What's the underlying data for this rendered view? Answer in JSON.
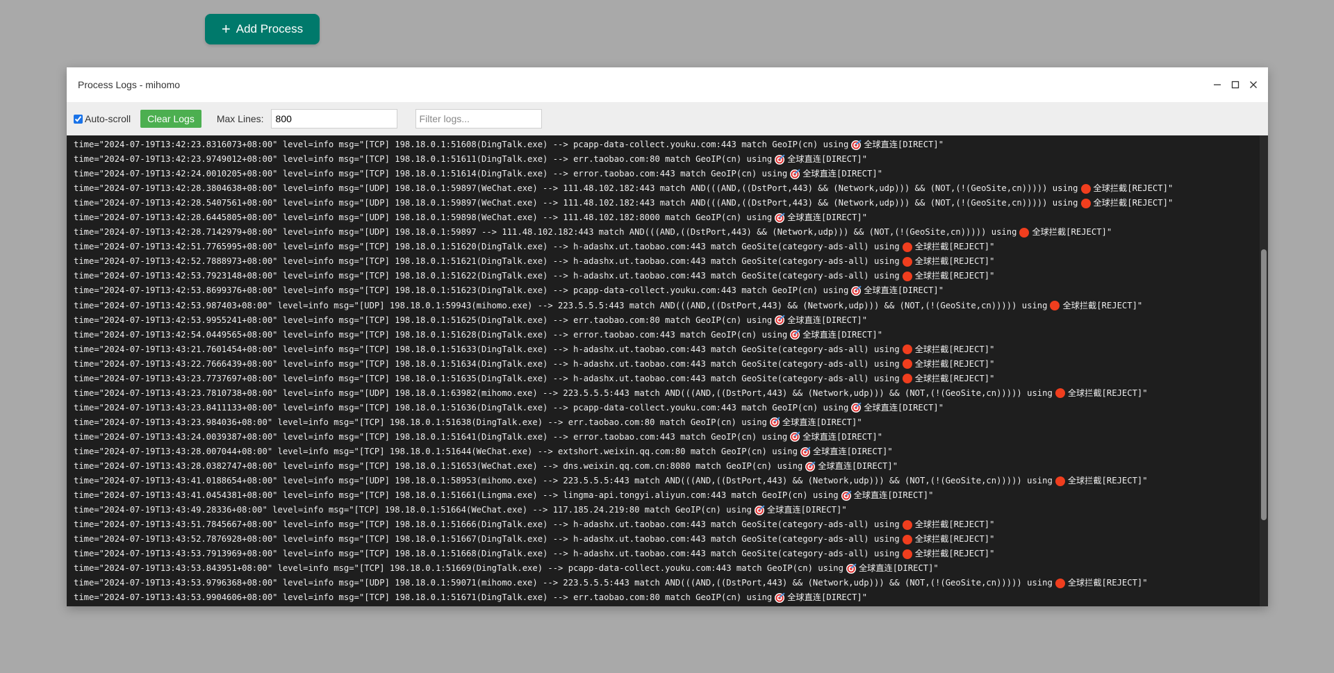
{
  "add_process": {
    "label": "Add Process",
    "icon": "plus-icon"
  },
  "modal": {
    "title": "Process Logs - mihomo",
    "controls": [
      "minimize-icon",
      "maximize-icon",
      "close-icon"
    ]
  },
  "toolbar": {
    "autoscroll_label": "Auto-scroll",
    "autoscroll_checked": true,
    "clear_label": "Clear Logs",
    "maxlines_label": "Max Lines:",
    "maxlines_value": "800",
    "filter_placeholder": "Filter logs..."
  },
  "colors": {
    "add_button": "#00796b",
    "clear_button": "#4caf50",
    "log_background": "#1e1e1e",
    "overlay": "#a9a9a9"
  },
  "logs": [
    {
      "pre": "time=\"2024-07-19T13:42:23.8316073+08:00\" level=info msg=\"[TCP] 198.18.0.1:51608(DingTalk.exe) --> pcapp-data-collect.youku.com:443 match GeoIP(cn) using",
      "emoji": "target",
      "post": "全球直连[DIRECT]\""
    },
    {
      "pre": "time=\"2024-07-19T13:42:23.9749012+08:00\" level=info msg=\"[TCP] 198.18.0.1:51611(DingTalk.exe) --> err.taobao.com:80 match GeoIP(cn) using",
      "emoji": "target",
      "post": "全球直连[DIRECT]\""
    },
    {
      "pre": "time=\"2024-07-19T13:42:24.0010205+08:00\" level=info msg=\"[TCP] 198.18.0.1:51614(DingTalk.exe) --> error.taobao.com:443 match GeoIP(cn) using",
      "emoji": "target",
      "post": "全球直连[DIRECT]\""
    },
    {
      "pre": "time=\"2024-07-19T13:42:28.3804638+08:00\" level=info msg=\"[UDP] 198.18.0.1:59897(WeChat.exe) --> 111.48.102.182:443 match AND(((AND,((DstPort,443) && (Network,udp))) && (NOT,(!(GeoSite,cn))))) using",
      "emoji": "circle",
      "post": "全球拦截[REJECT]\""
    },
    {
      "pre": "time=\"2024-07-19T13:42:28.5407561+08:00\" level=info msg=\"[UDP] 198.18.0.1:59897(WeChat.exe) --> 111.48.102.182:443 match AND(((AND,((DstPort,443) && (Network,udp))) && (NOT,(!(GeoSite,cn))))) using",
      "emoji": "circle",
      "post": "全球拦截[REJECT]\""
    },
    {
      "pre": "time=\"2024-07-19T13:42:28.6445805+08:00\" level=info msg=\"[UDP] 198.18.0.1:59898(WeChat.exe) --> 111.48.102.182:8000 match GeoIP(cn) using",
      "emoji": "target",
      "post": "全球直连[DIRECT]\""
    },
    {
      "pre": "time=\"2024-07-19T13:42:28.7142979+08:00\" level=info msg=\"[UDP] 198.18.0.1:59897 --> 111.48.102.182:443 match AND(((AND,((DstPort,443) && (Network,udp))) && (NOT,(!(GeoSite,cn))))) using",
      "emoji": "circle",
      "post": "全球拦截[REJECT]\""
    },
    {
      "pre": "time=\"2024-07-19T13:42:51.7765995+08:00\" level=info msg=\"[TCP] 198.18.0.1:51620(DingTalk.exe) --> h-adashx.ut.taobao.com:443 match GeoSite(category-ads-all) using",
      "emoji": "circle",
      "post": "全球拦截[REJECT]\""
    },
    {
      "pre": "time=\"2024-07-19T13:42:52.7888973+08:00\" level=info msg=\"[TCP] 198.18.0.1:51621(DingTalk.exe) --> h-adashx.ut.taobao.com:443 match GeoSite(category-ads-all) using",
      "emoji": "circle",
      "post": "全球拦截[REJECT]\""
    },
    {
      "pre": "time=\"2024-07-19T13:42:53.7923148+08:00\" level=info msg=\"[TCP] 198.18.0.1:51622(DingTalk.exe) --> h-adashx.ut.taobao.com:443 match GeoSite(category-ads-all) using",
      "emoji": "circle",
      "post": "全球拦截[REJECT]\""
    },
    {
      "pre": "time=\"2024-07-19T13:42:53.8699376+08:00\" level=info msg=\"[TCP] 198.18.0.1:51623(DingTalk.exe) --> pcapp-data-collect.youku.com:443 match GeoIP(cn) using",
      "emoji": "target",
      "post": "全球直连[DIRECT]\""
    },
    {
      "pre": "time=\"2024-07-19T13:42:53.987403+08:00\" level=info msg=\"[UDP] 198.18.0.1:59943(mihomo.exe) --> 223.5.5.5:443 match AND(((AND,((DstPort,443) && (Network,udp))) && (NOT,(!(GeoSite,cn))))) using",
      "emoji": "circle",
      "post": "全球拦截[REJECT]\""
    },
    {
      "pre": "time=\"2024-07-19T13:42:53.9955241+08:00\" level=info msg=\"[TCP] 198.18.0.1:51625(DingTalk.exe) --> err.taobao.com:80 match GeoIP(cn) using",
      "emoji": "target",
      "post": "全球直连[DIRECT]\""
    },
    {
      "pre": "time=\"2024-07-19T13:42:54.0449565+08:00\" level=info msg=\"[TCP] 198.18.0.1:51628(DingTalk.exe) --> error.taobao.com:443 match GeoIP(cn) using",
      "emoji": "target",
      "post": "全球直连[DIRECT]\""
    },
    {
      "pre": "time=\"2024-07-19T13:43:21.7601454+08:00\" level=info msg=\"[TCP] 198.18.0.1:51633(DingTalk.exe) --> h-adashx.ut.taobao.com:443 match GeoSite(category-ads-all) using",
      "emoji": "circle",
      "post": "全球拦截[REJECT]\""
    },
    {
      "pre": "time=\"2024-07-19T13:43:22.7666439+08:00\" level=info msg=\"[TCP] 198.18.0.1:51634(DingTalk.exe) --> h-adashx.ut.taobao.com:443 match GeoSite(category-ads-all) using",
      "emoji": "circle",
      "post": "全球拦截[REJECT]\""
    },
    {
      "pre": "time=\"2024-07-19T13:43:23.7737697+08:00\" level=info msg=\"[TCP] 198.18.0.1:51635(DingTalk.exe) --> h-adashx.ut.taobao.com:443 match GeoSite(category-ads-all) using",
      "emoji": "circle",
      "post": "全球拦截[REJECT]\""
    },
    {
      "pre": "time=\"2024-07-19T13:43:23.7810738+08:00\" level=info msg=\"[UDP] 198.18.0.1:63982(mihomo.exe) --> 223.5.5.5:443 match AND(((AND,((DstPort,443) && (Network,udp))) && (NOT,(!(GeoSite,cn))))) using",
      "emoji": "circle",
      "post": "全球拦截[REJECT]\""
    },
    {
      "pre": "time=\"2024-07-19T13:43:23.8411133+08:00\" level=info msg=\"[TCP] 198.18.0.1:51636(DingTalk.exe) --> pcapp-data-collect.youku.com:443 match GeoIP(cn) using",
      "emoji": "target",
      "post": "全球直连[DIRECT]\""
    },
    {
      "pre": "time=\"2024-07-19T13:43:23.984036+08:00\" level=info msg=\"[TCP] 198.18.0.1:51638(DingTalk.exe) --> err.taobao.com:80 match GeoIP(cn) using",
      "emoji": "target",
      "post": "全球直连[DIRECT]\""
    },
    {
      "pre": "time=\"2024-07-19T13:43:24.0039387+08:00\" level=info msg=\"[TCP] 198.18.0.1:51641(DingTalk.exe) --> error.taobao.com:443 match GeoIP(cn) using",
      "emoji": "target",
      "post": "全球直连[DIRECT]\""
    },
    {
      "pre": "time=\"2024-07-19T13:43:28.007044+08:00\" level=info msg=\"[TCP] 198.18.0.1:51644(WeChat.exe) --> extshort.weixin.qq.com:80 match GeoIP(cn) using",
      "emoji": "target",
      "post": "全球直连[DIRECT]\""
    },
    {
      "pre": "time=\"2024-07-19T13:43:28.0382747+08:00\" level=info msg=\"[TCP] 198.18.0.1:51653(WeChat.exe) --> dns.weixin.qq.com.cn:8080 match GeoIP(cn) using",
      "emoji": "target",
      "post": "全球直连[DIRECT]\""
    },
    {
      "pre": "time=\"2024-07-19T13:43:41.0188654+08:00\" level=info msg=\"[UDP] 198.18.0.1:58953(mihomo.exe) --> 223.5.5.5:443 match AND(((AND,((DstPort,443) && (Network,udp))) && (NOT,(!(GeoSite,cn))))) using",
      "emoji": "circle",
      "post": "全球拦截[REJECT]\""
    },
    {
      "pre": "time=\"2024-07-19T13:43:41.0454381+08:00\" level=info msg=\"[TCP] 198.18.0.1:51661(Lingma.exe) --> lingma-api.tongyi.aliyun.com:443 match GeoIP(cn) using",
      "emoji": "target",
      "post": "全球直连[DIRECT]\""
    },
    {
      "pre": "time=\"2024-07-19T13:43:49.28336+08:00\" level=info msg=\"[TCP] 198.18.0.1:51664(WeChat.exe) --> 117.185.24.219:80 match GeoIP(cn) using",
      "emoji": "target",
      "post": "全球直连[DIRECT]\""
    },
    {
      "pre": "time=\"2024-07-19T13:43:51.7845667+08:00\" level=info msg=\"[TCP] 198.18.0.1:51666(DingTalk.exe) --> h-adashx.ut.taobao.com:443 match GeoSite(category-ads-all) using",
      "emoji": "circle",
      "post": "全球拦截[REJECT]\""
    },
    {
      "pre": "time=\"2024-07-19T13:43:52.7876928+08:00\" level=info msg=\"[TCP] 198.18.0.1:51667(DingTalk.exe) --> h-adashx.ut.taobao.com:443 match GeoSite(category-ads-all) using",
      "emoji": "circle",
      "post": "全球拦截[REJECT]\""
    },
    {
      "pre": "time=\"2024-07-19T13:43:53.7913969+08:00\" level=info msg=\"[TCP] 198.18.0.1:51668(DingTalk.exe) --> h-adashx.ut.taobao.com:443 match GeoSite(category-ads-all) using",
      "emoji": "circle",
      "post": "全球拦截[REJECT]\""
    },
    {
      "pre": "time=\"2024-07-19T13:43:53.843951+08:00\" level=info msg=\"[TCP] 198.18.0.1:51669(DingTalk.exe) --> pcapp-data-collect.youku.com:443 match GeoIP(cn) using",
      "emoji": "target",
      "post": "全球直连[DIRECT]\""
    },
    {
      "pre": "time=\"2024-07-19T13:43:53.9796368+08:00\" level=info msg=\"[UDP] 198.18.0.1:59071(mihomo.exe) --> 223.5.5.5:443 match AND(((AND,((DstPort,443) && (Network,udp))) && (NOT,(!(GeoSite,cn))))) using",
      "emoji": "circle",
      "post": "全球拦截[REJECT]\""
    },
    {
      "pre": "time=\"2024-07-19T13:43:53.9904606+08:00\" level=info msg=\"[TCP] 198.18.0.1:51671(DingTalk.exe) --> err.taobao.com:80 match GeoIP(cn) using",
      "emoji": "target",
      "post": "全球直连[DIRECT]\""
    }
  ]
}
